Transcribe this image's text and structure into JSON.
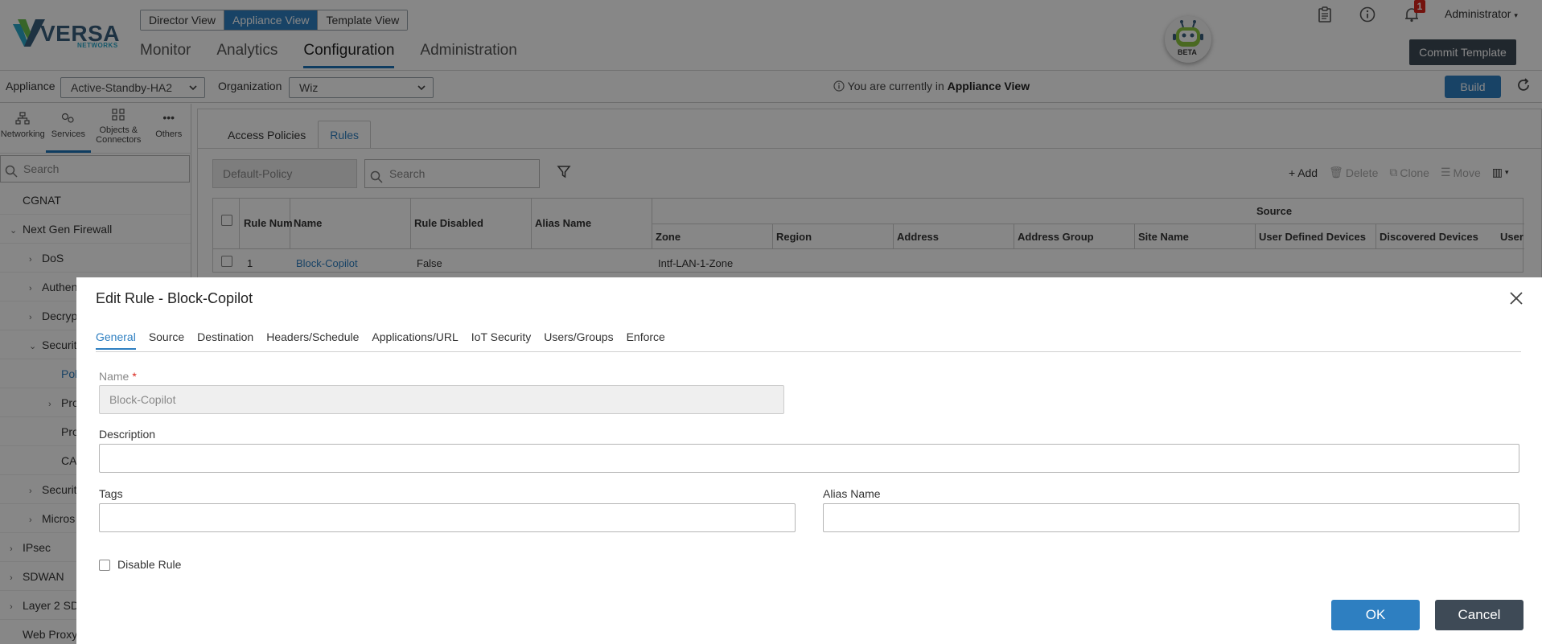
{
  "header": {
    "logo_text": "VERSA",
    "logo_sub": "NETWORKS",
    "view_switch": [
      "Director View",
      "Appliance View",
      "Template View"
    ],
    "main_nav": [
      "Monitor",
      "Analytics",
      "Configuration",
      "Administration"
    ],
    "beta_label": "BETA",
    "notification_count": "1",
    "user": "Administrator",
    "commit_label": "Commit Template"
  },
  "appliance_bar": {
    "appliance_label": "Appliance",
    "appliance_value": "Active-Standby-HA2",
    "organization_label": "Organization",
    "organization_value": "Wiz",
    "info_prefix": "You are currently in",
    "info_view": "Appliance View",
    "build_label": "Build"
  },
  "left_panel": {
    "tabs": [
      "Networking",
      "Services",
      "Objects & Connectors",
      "Others"
    ],
    "search_placeholder": "Search",
    "tree": [
      {
        "label": "CGNAT"
      },
      {
        "label": "Next Gen Firewall"
      },
      {
        "label": "DoS"
      },
      {
        "label": "Authen"
      },
      {
        "label": "Decryp"
      },
      {
        "label": "Securit"
      },
      {
        "label": "Pol"
      },
      {
        "label": "Pro"
      },
      {
        "label": "Pro"
      },
      {
        "label": "CA"
      },
      {
        "label": "Securit"
      },
      {
        "label": "Micros"
      },
      {
        "label": "IPsec"
      },
      {
        "label": "SDWAN"
      },
      {
        "label": "Layer 2 SD"
      },
      {
        "label": "Web Proxy"
      }
    ]
  },
  "content": {
    "tabs": [
      "Access Policies",
      "Rules"
    ],
    "policy_value": "Default-Policy",
    "search_placeholder": "Search",
    "actions": [
      "Add",
      "Delete",
      "Clone",
      "Move"
    ],
    "table": {
      "source_group": "Source",
      "headers": [
        "Rule Num",
        "Name",
        "Rule Disabled",
        "Alias Name"
      ],
      "source_headers": [
        "Zone",
        "Region",
        "Address",
        "Address Group",
        "Site Name",
        "User Defined Devices",
        "Discovered Devices",
        "User"
      ],
      "rows": [
        {
          "num": "1",
          "name": "Block-Copilot",
          "disabled": "False",
          "alias": "",
          "zone": "Intf-LAN-1-Zone"
        }
      ]
    }
  },
  "modal": {
    "title": "Edit Rule - Block-Copilot",
    "tabs": [
      "General",
      "Source",
      "Destination",
      "Headers/Schedule",
      "Applications/URL",
      "IoT Security",
      "Users/Groups",
      "Enforce"
    ],
    "name_label": "Name",
    "name_required": "*",
    "name_value": "Block-Copilot",
    "description_label": "Description",
    "description_value": "",
    "tags_label": "Tags",
    "tags_value": "",
    "alias_label": "Alias Name",
    "alias_value": "",
    "disable_rule_label": "Disable Rule",
    "ok_label": "OK",
    "cancel_label": "Cancel"
  }
}
